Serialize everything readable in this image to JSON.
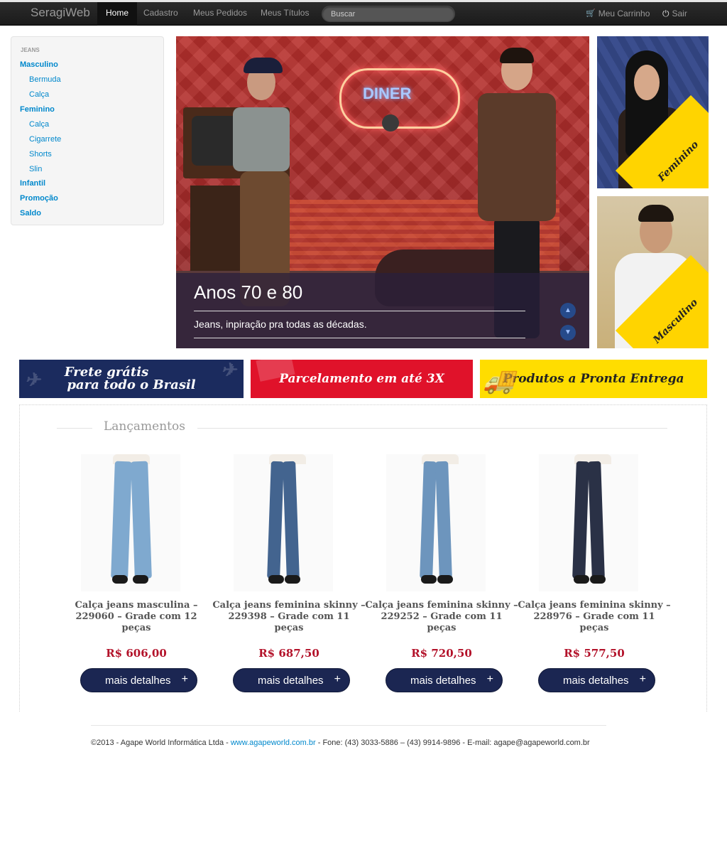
{
  "navbar": {
    "brand": "SeragiWeb",
    "items": [
      {
        "label": "Home",
        "active": true
      },
      {
        "label": "Cadastro"
      },
      {
        "label": "Meus Pedidos"
      },
      {
        "label": "Meus Títulos"
      }
    ],
    "search_placeholder": "Buscar",
    "cart_label": "Meu Carrinho",
    "exit_label": "Sair"
  },
  "sidebar": {
    "header": "JEANS",
    "items": [
      {
        "label": "Masculino",
        "level": 0
      },
      {
        "label": "Bermuda",
        "level": 1
      },
      {
        "label": "Calça",
        "level": 1
      },
      {
        "label": "Feminino",
        "level": 0
      },
      {
        "label": "Calça",
        "level": 1
      },
      {
        "label": "Cigarrete",
        "level": 1
      },
      {
        "label": "Shorts",
        "level": 1
      },
      {
        "label": "Slin",
        "level": 1
      },
      {
        "label": "Infantil",
        "level": 0
      },
      {
        "label": "Promoção",
        "level": 0
      },
      {
        "label": "Saldo",
        "level": 0
      }
    ]
  },
  "hero": {
    "neon_text": "DINER",
    "title": "Anos 70 e 80",
    "subtitle": "Jeans, inpiração pra todas as décadas."
  },
  "promos": {
    "feminino": "Feminino",
    "masculino": "Masculino"
  },
  "banners": {
    "frete_line1": "Frete grátis",
    "frete_line2": "para todo o Brasil",
    "parcelamento": "Parcelamento em até 3X",
    "pronta_entrega": "Produtos a Pronta Entrega"
  },
  "section_title": "Lançamentos",
  "products": [
    {
      "title": "Calça jeans masculina – 229060 – Grade com 12 peças",
      "price": "R$ 606,00",
      "button": "mais detalhes",
      "color": "#7fa9cf",
      "gender": "m"
    },
    {
      "title": "Calça jeans feminina skinny – 229398 – Grade com 11 peças",
      "price": "R$ 687,50",
      "button": "mais detalhes",
      "color": "#43648f",
      "gender": "f"
    },
    {
      "title": "Calça jeans feminina skinny – 229252 – Grade com 11 peças",
      "price": "R$ 720,50",
      "button": "mais detalhes",
      "color": "#6d95bd",
      "gender": "f"
    },
    {
      "title": "Calça jeans feminina skinny – 228976 – Grade com 11 peças",
      "price": "R$ 577,50",
      "button": "mais detalhes",
      "color": "#2a3146",
      "gender": "f"
    }
  ],
  "footer": {
    "prefix": "©2013 - Agape World Informática Ltda - ",
    "link": "www.agapeworld.com.br",
    "suffix": " - Fone: (43) 3033-5886 – (43) 9914-9896 - E-mail: agape@agapeworld.com.br"
  }
}
